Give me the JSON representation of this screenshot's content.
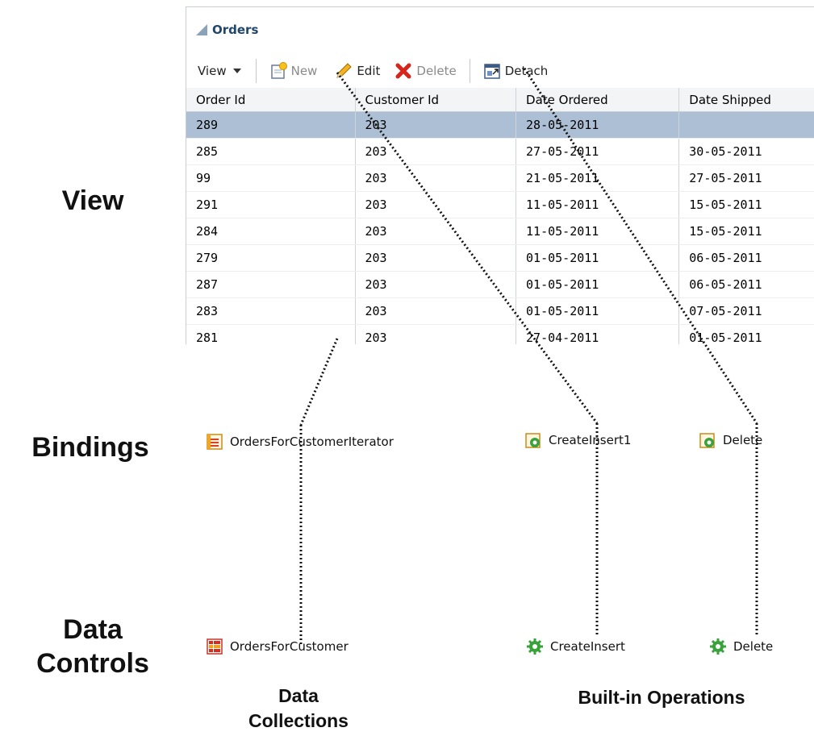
{
  "layers": {
    "view": "View",
    "bindings": "Bindings",
    "data_controls_line1": "Data",
    "data_controls_line2": "Controls"
  },
  "panel": {
    "title": "Orders",
    "toolbar": {
      "view": "View",
      "new": "New",
      "edit": "Edit",
      "delete": "Delete",
      "detach": "Detach"
    },
    "columns": [
      "Order Id",
      "Customer Id",
      "Date Ordered",
      "Date Shipped"
    ],
    "rows": [
      [
        "289",
        "203",
        "28-05-2011",
        ""
      ],
      [
        "285",
        "203",
        "27-05-2011",
        "30-05-2011"
      ],
      [
        "99",
        "203",
        "21-05-2011",
        "27-05-2011"
      ],
      [
        "291",
        "203",
        "11-05-2011",
        "15-05-2011"
      ],
      [
        "284",
        "203",
        "11-05-2011",
        "15-05-2011"
      ],
      [
        "279",
        "203",
        "01-05-2011",
        "06-05-2011"
      ],
      [
        "287",
        "203",
        "01-05-2011",
        "06-05-2011"
      ],
      [
        "283",
        "203",
        "01-05-2011",
        "07-05-2011"
      ],
      [
        "281",
        "203",
        "27-04-2011",
        "01-05-2011"
      ]
    ],
    "selected_row": 0
  },
  "bindings": {
    "iterator": "OrdersForCustomerIterator",
    "create_insert": "CreateInsert1",
    "delete": "Delete"
  },
  "data_controls": {
    "collection": "OrdersForCustomer",
    "create_insert": "CreateInsert",
    "delete": "Delete"
  },
  "captions": {
    "data_collections_line1": "Data",
    "data_collections_line2": "Collections",
    "builtin_operations": "Built-in Operations"
  },
  "icons": {
    "view_dropdown": "chevron-down-icon",
    "new": "new-document-icon",
    "edit": "pencil-icon",
    "delete": "red-x-icon",
    "detach": "detach-icon",
    "iterator": "iterator-icon",
    "action_binding": "action-binding-icon",
    "collection": "collection-icon",
    "operation": "gear-icon"
  },
  "colors": {
    "selected_row": "#adbfd4",
    "title": "#21466b",
    "gear": "#3aa23a",
    "delete_x": "#d9241b"
  }
}
